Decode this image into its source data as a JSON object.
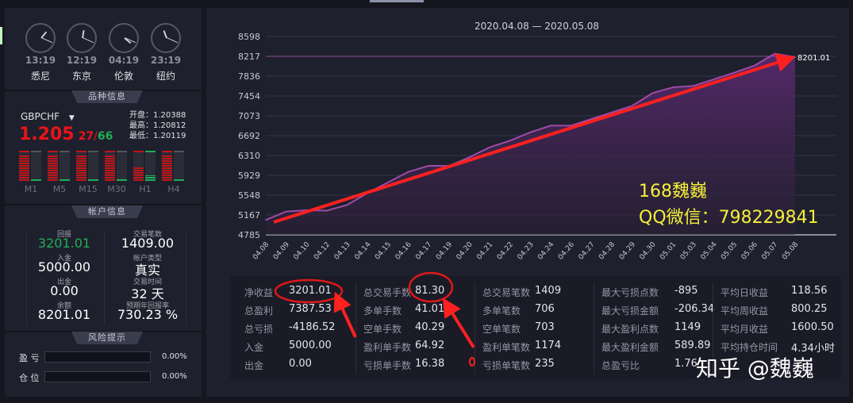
{
  "clocks": [
    {
      "time": "13:19",
      "city": "悉尼",
      "h": 1,
      "m": 19
    },
    {
      "time": "12:19",
      "city": "东京",
      "h": 12,
      "m": 19
    },
    {
      "time": "04:19",
      "city": "伦敦",
      "h": 4,
      "m": 19
    },
    {
      "time": "23:19",
      "city": "纽约",
      "h": 11,
      "m": 19
    }
  ],
  "symbol_section": {
    "title": "品种信息",
    "symbol": "GBPCHF",
    "price_main": "1.205",
    "price_bid": "27",
    "price_slash": "/",
    "price_ask": "66",
    "open_label": "开盘：1.20388",
    "high_label": "最高：1.20812",
    "low_label": "最低：1.20119",
    "timeframes": [
      {
        "name": "M1",
        "sell": 0.9,
        "buy": 0.05
      },
      {
        "name": "M5",
        "sell": 0.9,
        "buy": 0.05
      },
      {
        "name": "M15",
        "sell": 0.9,
        "buy": 0.05
      },
      {
        "name": "M30",
        "sell": 0.9,
        "buy": 0.05
      },
      {
        "name": "H1",
        "sell": 0.5,
        "buy": 0.2
      },
      {
        "name": "H4",
        "sell": 0.9,
        "buy": 0.05
      }
    ]
  },
  "account": {
    "title": "帐户信息",
    "items": [
      {
        "label": "回报",
        "value": "3201.01"
      },
      {
        "label": "交易笔数",
        "value": "1409.00"
      },
      {
        "label": "入金",
        "value": "5000.00"
      },
      {
        "label": "帐户类型",
        "value": "真实"
      },
      {
        "label": "出金",
        "value": "0.00"
      },
      {
        "label": "交易时间",
        "value": "32 天"
      },
      {
        "label": "余额",
        "value": "8201.01"
      },
      {
        "label": "预期年回报率",
        "value": "730.23 %"
      }
    ]
  },
  "risk": {
    "title": "风险提示",
    "rows": [
      {
        "label": "盈 亏",
        "value": "0.00%",
        "level": 0
      },
      {
        "label": "仓 位",
        "value": "0.00%",
        "level": 0
      }
    ]
  },
  "colors": {
    "up": "#1fae55",
    "down": "#e8141a",
    "line": "#a04aa8",
    "fill": "#4a2560",
    "annotation": "#ff2020",
    "watermark": "#f4ef3a"
  },
  "chart_data": {
    "type": "area",
    "title": "2020.04.08 — 2020.05.08",
    "x": [
      "04.08",
      "04.09",
      "04.10",
      "04.12",
      "04.13",
      "04.14",
      "04.15",
      "04.16",
      "04.17",
      "04.19",
      "04.20",
      "04.21",
      "04.22",
      "04.23",
      "04.24",
      "04.26",
      "04.27",
      "04.28",
      "04.29",
      "04.30",
      "05.01",
      "05.03",
      "05.04",
      "05.05",
      "05.06",
      "05.07",
      "05.08"
    ],
    "values": [
      5070,
      5232,
      5258,
      5250,
      5360,
      5589,
      5792,
      5995,
      6112,
      6110,
      6275,
      6467,
      6595,
      6757,
      6885,
      6885,
      7012,
      7138,
      7265,
      7510,
      7621,
      7647,
      7774,
      7901,
      8038,
      8267,
      8201.01
    ],
    "yticks": [
      "8598",
      "8217",
      "7836",
      "7454",
      "7073",
      "6692",
      "6310",
      "5929",
      "5548",
      "5167",
      "4785"
    ],
    "ylim": [
      4785,
      8598
    ],
    "reference_value": 8217,
    "last_label": "8201.01",
    "grid": true
  },
  "stats": [
    [
      {
        "l": "净收益",
        "v": "3201.01"
      },
      {
        "l": "总盈利",
        "v": "7387.53"
      },
      {
        "l": "总亏损",
        "v": "-4186.52"
      },
      {
        "l": "入金",
        "v": "5000.00"
      },
      {
        "l": "出金",
        "v": "0.00"
      }
    ],
    [
      {
        "l": "总交易手数",
        "v": "81.30"
      },
      {
        "l": "多单手数",
        "v": "41.01"
      },
      {
        "l": "空单手数",
        "v": "40.29"
      },
      {
        "l": "盈利单手数",
        "v": "64.92"
      },
      {
        "l": "亏损单手数",
        "v": "16.38"
      }
    ],
    [
      {
        "l": "总交易笔数",
        "v": "1409"
      },
      {
        "l": "多单笔数",
        "v": "706"
      },
      {
        "l": "空单笔数",
        "v": "703"
      },
      {
        "l": "盈利单笔数",
        "v": "1174"
      },
      {
        "l": "亏损单笔数",
        "v": "235"
      }
    ],
    [
      {
        "l": "最大亏损点数",
        "v": "-895"
      },
      {
        "l": "最大亏损金额",
        "v": "-206.34"
      },
      {
        "l": "最大盈利点数",
        "v": "1149"
      },
      {
        "l": "最大盈利金额",
        "v": "589.89"
      },
      {
        "l": "总盈亏比",
        "v": "1.76"
      }
    ],
    [
      {
        "l": "平均日收益",
        "v": "118.56"
      },
      {
        "l": "平均周收益",
        "v": "800.25"
      },
      {
        "l": "平均月收益",
        "v": "1600.50"
      },
      {
        "l": "平均持仓时间",
        "v": "4.34小时"
      }
    ]
  ],
  "watermarks": {
    "line1": "168魏巍",
    "line2": "QQ微信：798229841",
    "zhihu": "知乎 @魏巍"
  }
}
